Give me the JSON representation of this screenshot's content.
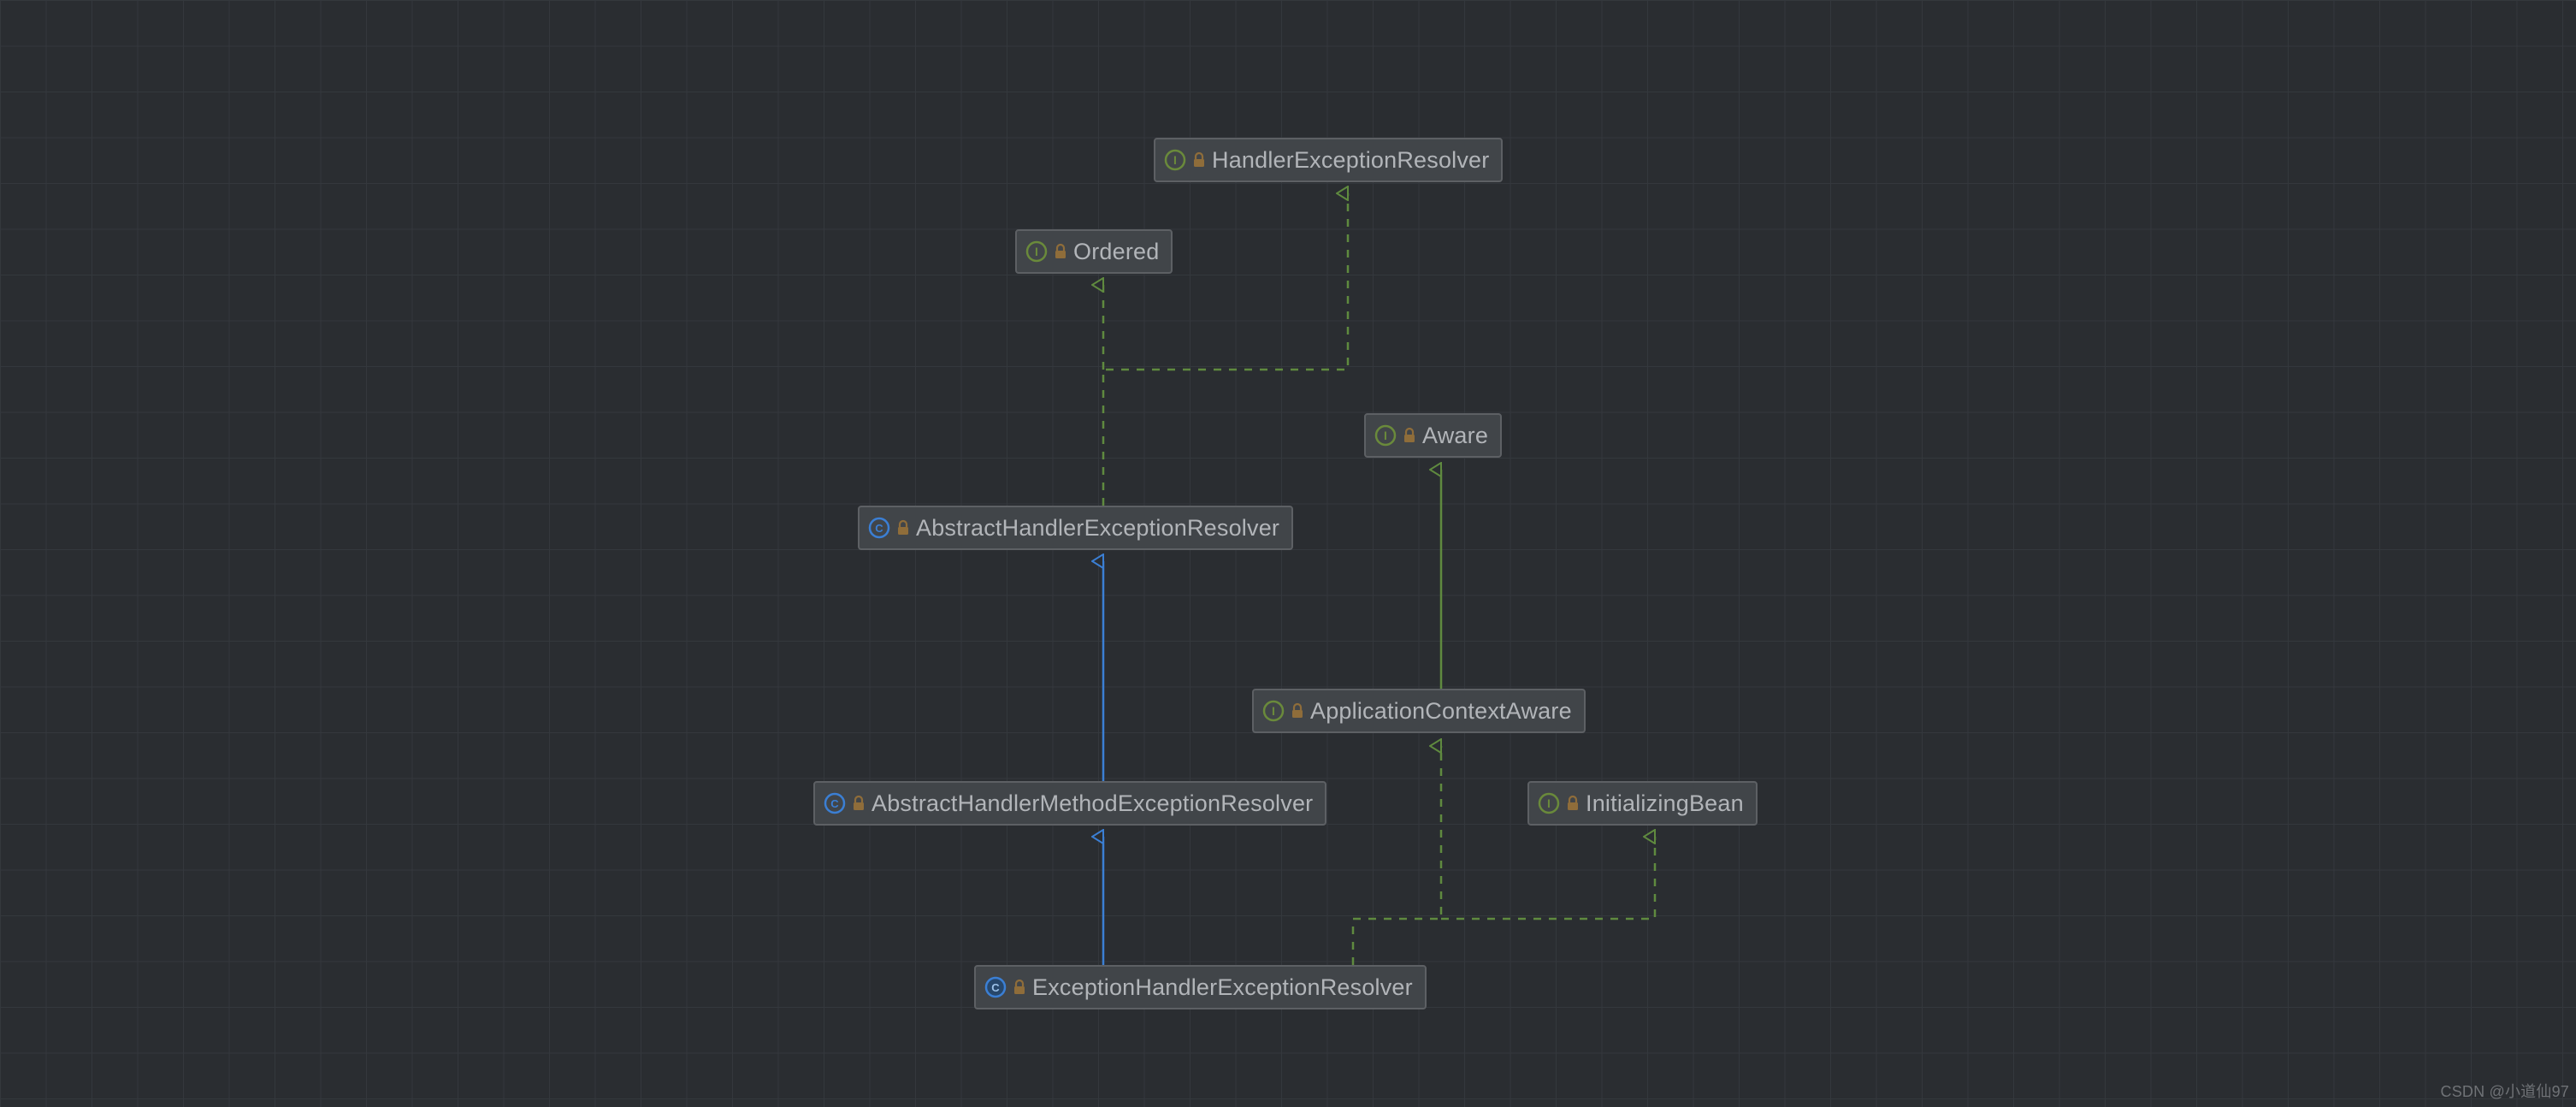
{
  "watermark": "CSDN @小道仙97",
  "colors": {
    "blue_line": "#3b7fd4",
    "green_dash": "#5f8a3f",
    "green_solid": "#5f8a3f",
    "interface_ring": "#6a8a3b",
    "class_ring": "#3b7fd4",
    "lock_body": "#8f6d3a"
  },
  "nodes": {
    "handlerExceptionResolver": {
      "label": "HandlerExceptionResolver",
      "kind": "interface"
    },
    "ordered": {
      "label": "Ordered",
      "kind": "interface"
    },
    "aware": {
      "label": "Aware",
      "kind": "interface"
    },
    "abstractHandlerExceptionResolver": {
      "label": "AbstractHandlerExceptionResolver",
      "kind": "class"
    },
    "applicationContextAware": {
      "label": "ApplicationContextAware",
      "kind": "interface"
    },
    "abstractHandlerMethodExceptionResolver": {
      "label": "AbstractHandlerMethodExceptionResolver",
      "kind": "class"
    },
    "initializingBean": {
      "label": "InitializingBean",
      "kind": "interface"
    },
    "exceptionHandlerExceptionResolver": {
      "label": "ExceptionHandlerExceptionResolver",
      "kind": "class"
    }
  },
  "chart_data": {
    "type": "uml_class_hierarchy",
    "classes": [
      {
        "id": "HandlerExceptionResolver",
        "stereotype": "interface"
      },
      {
        "id": "Ordered",
        "stereotype": "interface"
      },
      {
        "id": "Aware",
        "stereotype": "interface"
      },
      {
        "id": "AbstractHandlerExceptionResolver",
        "stereotype": "abstract_class"
      },
      {
        "id": "ApplicationContextAware",
        "stereotype": "interface"
      },
      {
        "id": "AbstractHandlerMethodExceptionResolver",
        "stereotype": "abstract_class"
      },
      {
        "id": "InitializingBean",
        "stereotype": "interface"
      },
      {
        "id": "ExceptionHandlerExceptionResolver",
        "stereotype": "class"
      }
    ],
    "relations": [
      {
        "from": "AbstractHandlerExceptionResolver",
        "to": "Ordered",
        "type": "implements"
      },
      {
        "from": "AbstractHandlerExceptionResolver",
        "to": "HandlerExceptionResolver",
        "type": "implements"
      },
      {
        "from": "ApplicationContextAware",
        "to": "Aware",
        "type": "extends_interface"
      },
      {
        "from": "AbstractHandlerMethodExceptionResolver",
        "to": "AbstractHandlerExceptionResolver",
        "type": "extends"
      },
      {
        "from": "ExceptionHandlerExceptionResolver",
        "to": "AbstractHandlerMethodExceptionResolver",
        "type": "extends"
      },
      {
        "from": "ExceptionHandlerExceptionResolver",
        "to": "ApplicationContextAware",
        "type": "implements"
      },
      {
        "from": "ExceptionHandlerExceptionResolver",
        "to": "InitializingBean",
        "type": "implements"
      }
    ]
  }
}
